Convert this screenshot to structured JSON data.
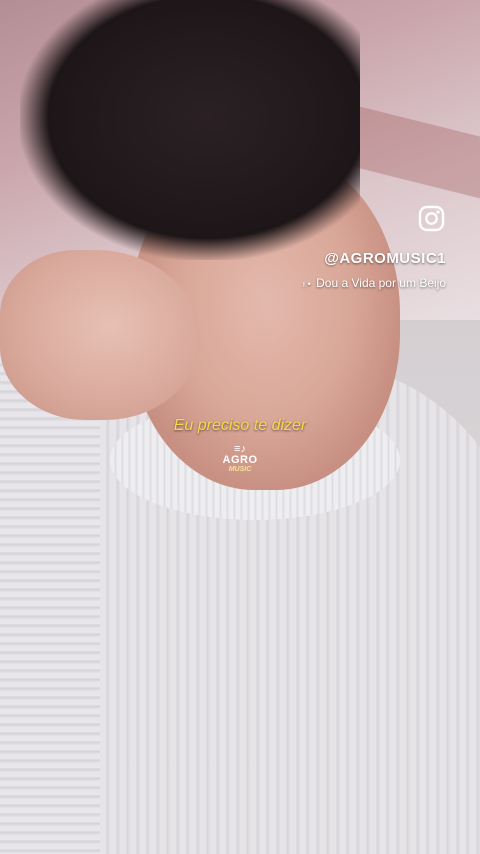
{
  "overlay": {
    "social_icon": "instagram-icon",
    "handle": "@AGROMUSIC1",
    "song_title": "Dou a Vida por um Beijo",
    "lyric": "Eu preciso te dizer",
    "logo": {
      "note_icon": "music-note-icon",
      "line1": "AGRO",
      "line2": "MUSIC"
    },
    "colors": {
      "lyric": "#f7d94a",
      "text": "#ffffff"
    }
  }
}
